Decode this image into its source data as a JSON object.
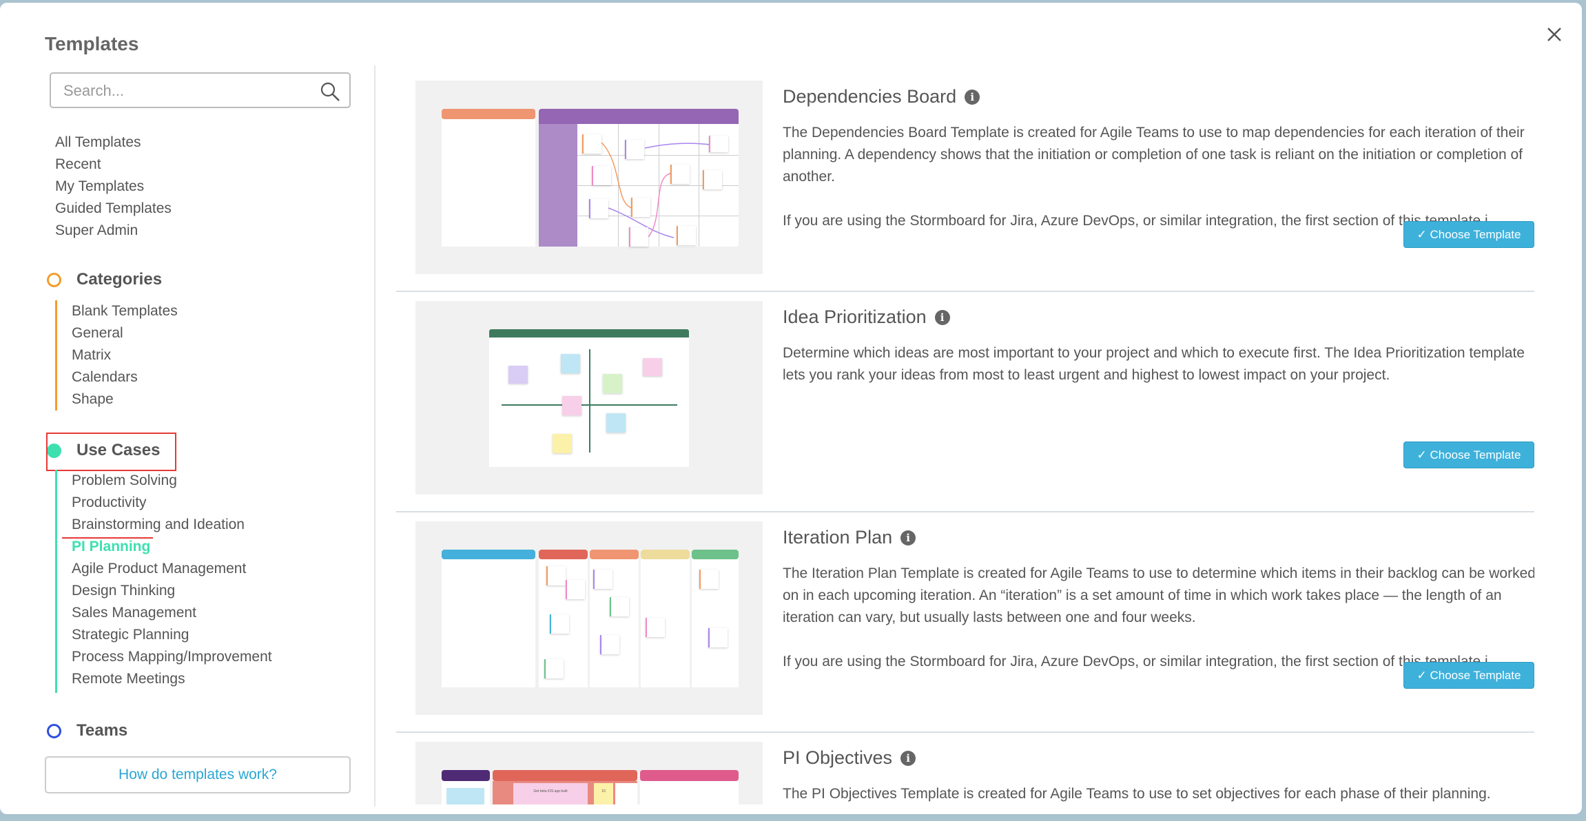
{
  "header": {
    "title": "Templates",
    "close_icon": "close-icon"
  },
  "search": {
    "placeholder": "Search...",
    "value": ""
  },
  "nav": [
    "All Templates",
    "Recent",
    "My Templates",
    "Guided Templates",
    "Super Admin"
  ],
  "categories": {
    "label": "Categories",
    "color": "#f39c2b",
    "items": [
      "Blank Templates",
      "General",
      "Matrix",
      "Calendars",
      "Shape"
    ]
  },
  "use_cases": {
    "label": "Use Cases",
    "color": "#3ee0b0",
    "active": "PI Planning",
    "items": [
      "Problem Solving",
      "Productivity",
      "Brainstorming and Ideation",
      "PI Planning",
      "Agile Product Management",
      "Design Thinking",
      "Sales Management",
      "Strategic Planning",
      "Process Mapping/Improvement",
      "Remote Meetings"
    ]
  },
  "teams": {
    "label": "Teams",
    "color": "#2f4fe0"
  },
  "help_button": "How do templates work?",
  "choose_label": "Choose Template",
  "templates": [
    {
      "title": "Dependencies Board",
      "desc": "The Dependencies Board Template is created for Agile Teams to use to map dependencies for each iteration of their planning. A dependency shows that the initiation or completion of one task is reliant on the initiation or completion of another.",
      "desc2": "If you are using the Stormboard for Jira, Azure DevOps, or similar integration, the first section of this template i...",
      "accent": "#9466b3"
    },
    {
      "title": "Idea Prioritization",
      "desc": "Determine which ideas are most important to your project and which to execute first. The Idea Prioritization template lets you rank your ideas from most to least urgent and highest to lowest impact on your project.",
      "desc2": "",
      "accent": "#3f7a5f"
    },
    {
      "title": "Iteration Plan",
      "desc": "The Iteration Plan Template is created for Agile Teams to use to determine which items in their backlog can be worked on in each upcoming iteration. An “iteration” is a set amount of time in which work takes place — the length of an iteration can vary, but usually lasts between one and four weeks.",
      "desc2": "If you are using the Stormboard for Jira, Azure DevOps, or similar integration, the first section of this template i...",
      "accent": "#45b0db"
    },
    {
      "title": "PI Objectives",
      "desc": "The PI Objectives Template is created for Agile Teams to use to set objectives for each phase of their planning.",
      "desc2": "",
      "accent": "#e0665a",
      "thumb_text": "Get beta iOS app built",
      "thumb_number": "10"
    }
  ]
}
